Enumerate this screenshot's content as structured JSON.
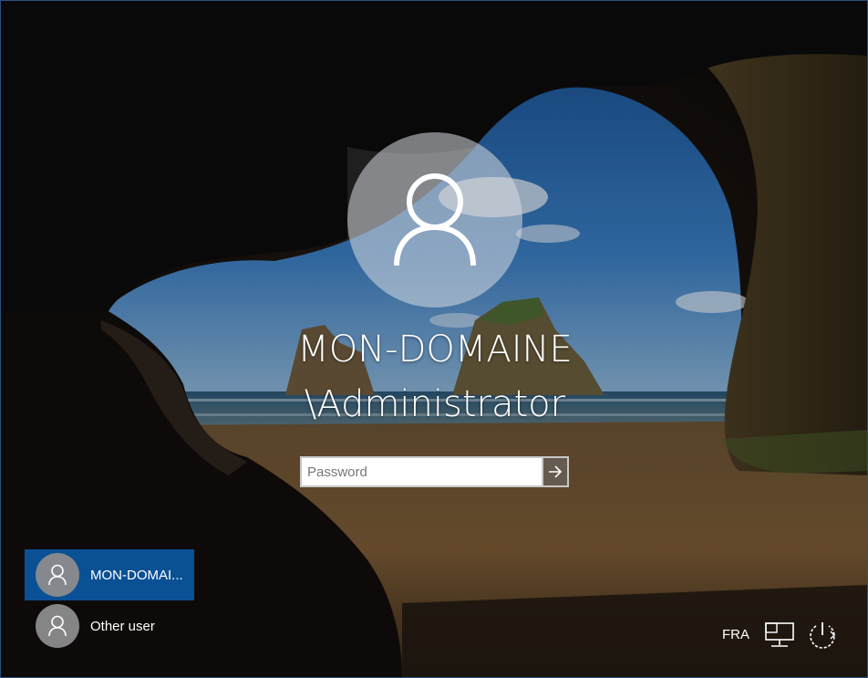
{
  "login": {
    "username_line1": "MON-DOMAINE",
    "username_line2": "\\Administrator",
    "password_placeholder": "Password",
    "password_value": "",
    "submit_icon": "arrow-right-icon"
  },
  "user_list": [
    {
      "name": "MON-DOMAI...",
      "selected": true
    },
    {
      "name": "Other user",
      "selected": false
    }
  ],
  "tray": {
    "language": "FRA",
    "network_icon": "network-icon",
    "power_icon": "power-icon"
  },
  "colors": {
    "selected_user_bg": "#0a5094",
    "window_border": "#2b4f82"
  }
}
